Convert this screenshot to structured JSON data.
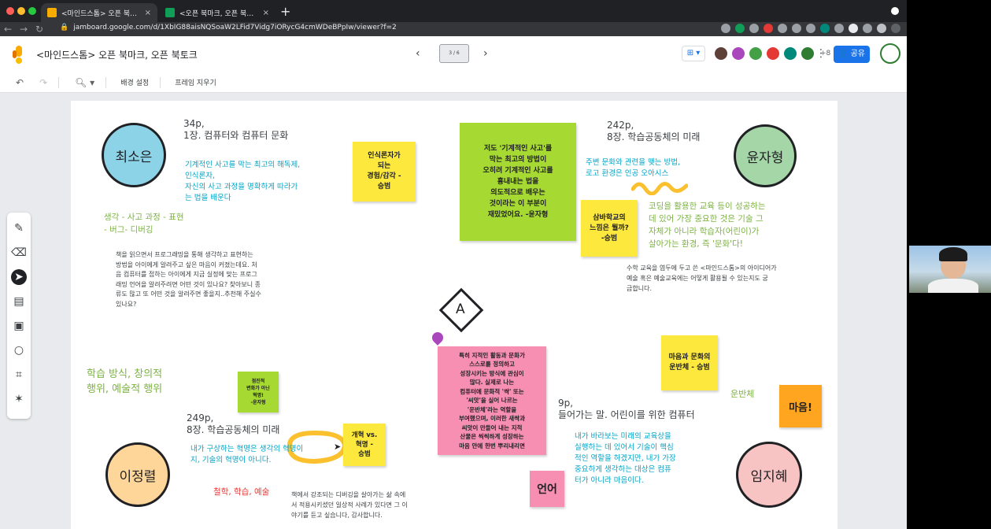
{
  "browser": {
    "tabs": [
      {
        "label": "<마인드스톰> 오픈 북마크, 오픈 북",
        "close": "×"
      },
      {
        "label": "<오픈 북마크, 오픈 북토크> 낭독 문",
        "close": "×"
      }
    ],
    "new_tab": "+",
    "url": "jamboard.google.com/d/1XbIG88aisNQSoaW2LFid7Vidg7iORycG4cmWDeBPpIw/viewer?f=2"
  },
  "header": {
    "title": "<마인드스톰> 오픈 북마크, 오픈 북토크",
    "frame_counter": "3 / 6",
    "extra_viewers": "+8",
    "share_label": "공유"
  },
  "toolbar": {
    "background_label": "배경 설정",
    "clear_frame_label": "프레임 지우기"
  },
  "board": {
    "names": {
      "top_left": "최소은",
      "top_right": "윤자형",
      "bottom_left": "이정렬",
      "bottom_right": "임지혜"
    },
    "center_symbol": "A",
    "tl_ref": "34p,\n1장. 컴퓨터와 컴퓨터 문화",
    "tl_quote": "기계적인 사고를 막는 최고의 해독제,\n인식론자,\n자신의 사고 과정을 명확하게 따라가\n는 법을 배운다",
    "tl_green": "생각 - 사고 과정 - 표현\n- 버그- 디버깅",
    "tl_question": "책을 읽으면서 프로그래밍을 통해 생각하고 표현하는\n방법을 아이에게 알려주고 싶은 마음이 커졌는데요. 처\n음 컴퓨터를 접하는 아이에게 지금 실정에 맞는 프로그\n래밍 언어을 알려주려면 어떤 것이 있나요? 찾아보니 종\n류도 많고 또 어떤 것을 알려주면 좋을지..추천해 주실수\n있나요?",
    "sticky_yellow_1": "인식론자가\n되는\n경험/감각 -\n승범",
    "sticky_green_big": "저도 '기계적인 사고'를\n막는 최고의 방법이\n오히려 기계적인 사고를\n흉내내는 법을\n의도적으로 배우는\n것이라는 이 부분이\n재밌었어요. -윤자형",
    "tr_ref": "242p,\n8장. 학습공동체의 미래",
    "tr_quote": "주변 문화와 관련을 맺는 방법,\n로고 환경은 인공 오아시스",
    "sticky_yellow_2": "삼바학교의\n느낌은 뭘까?\n-승범",
    "tr_green": "코딩을 활용한 교육 등이 성공하는\n데 있어 가장 중요한 것은 기술 그\n자체가 아니라 학습자(어린이)가\n살아가는 환경, 즉 '문화'다!",
    "tr_question": "수학 교육을 염두에 두고 쓴 <마인드스톰>의 아이디어가\n예술 혹은 예술교육에는 어떻게 활용될 수 있는지도 궁\n금합니다.",
    "sticky_pink": "특히 지적인 활동과 문화가\n스스로를 정의하고\n성장시키는 방식에 관심이\n많다. 실제로 나는\n컴퓨터에 문화적 '싹' 또는\n'씨앗'을 실어 나르는\n'운반체'라는 역할을\n부여했으며, 이러한 새싹과\n씨앗이 만들어 내는 지적\n산물은 씩씩하게 성장하는\n마음 안에 한번 뿌리내리면",
    "sticky_yellow_3": "마음과 문화의\n운반체 - 승범",
    "br_green": "운반체",
    "sticky_orange": "마음!",
    "br_ref": "9p,\n들어가는 말. 어린이를 위한 컴퓨터",
    "br_quote": "내가 바라보는 미래의 교육상을\n실행하는 데 있어서 기술이 핵심\n적인 역할을 하겠지만, 내가 가장\n중요하게 생각하는 대상은 컴퓨\n터가 아니라 마음이다.",
    "sticky_pink_small": "언어",
    "bl_green": "학습 방식, 창의적\n행위, 예술적 행위",
    "sticky_green_small": "점진적\n변화가 아닌\n혁명!\n-윤자형",
    "bl_ref": "249p,\n8장. 학습공동체의 미래",
    "bl_quote": "내가 구상하는 혁명은 생각의 혁명이\n지, 기술의 혁명이 아니다.",
    "sticky_yellow_4": "개혁 vs.\n혁명 -\n승범",
    "bl_red": "철학, 학습, 예술",
    "bl_question": "책에서 강조되는 디버깅을 살아가는 삶 속에\n서 적용시키셨던 일상적 사례가 있다면 그 이\n야기를 듣고 싶습니다, 감사합니다."
  },
  "colors": {
    "circle_blue": "#8dd3e8",
    "circle_green": "#a5d6a7",
    "circle_orange": "#ffd699",
    "circle_pink": "#f8c3c3",
    "sticky_yellow": "#fde83d",
    "sticky_green": "#a6d932",
    "sticky_pink": "#f78fb3",
    "sticky_orange": "#ffa51f",
    "text_blue": "#00a4c7",
    "text_green": "#7cb342"
  }
}
